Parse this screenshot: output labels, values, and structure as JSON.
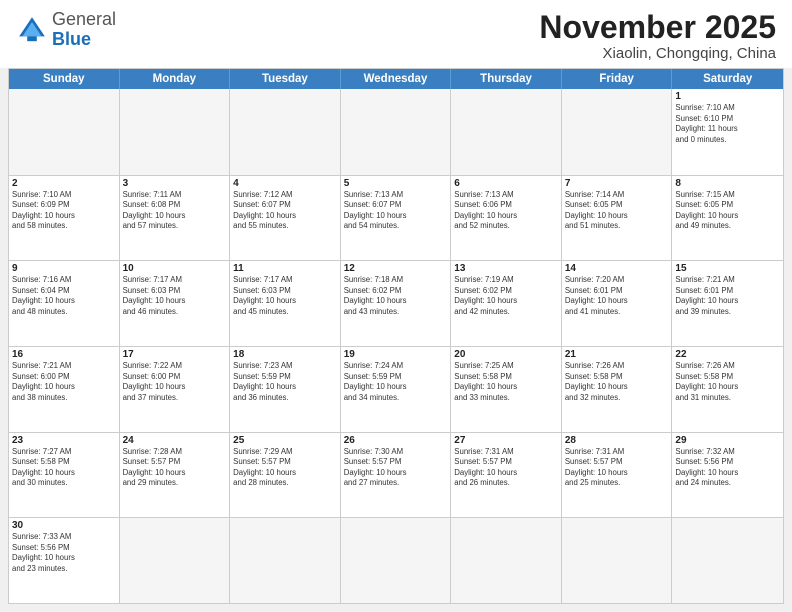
{
  "header": {
    "logo_general": "General",
    "logo_blue": "Blue",
    "month_title": "November 2025",
    "location": "Xiaolin, Chongqing, China"
  },
  "weekdays": [
    "Sunday",
    "Monday",
    "Tuesday",
    "Wednesday",
    "Thursday",
    "Friday",
    "Saturday"
  ],
  "weeks": [
    [
      {
        "day": "",
        "info": "",
        "empty": true
      },
      {
        "day": "",
        "info": "",
        "empty": true
      },
      {
        "day": "",
        "info": "",
        "empty": true
      },
      {
        "day": "",
        "info": "",
        "empty": true
      },
      {
        "day": "",
        "info": "",
        "empty": true
      },
      {
        "day": "",
        "info": "",
        "empty": true
      },
      {
        "day": "1",
        "info": "Sunrise: 7:10 AM\nSunset: 6:10 PM\nDaylight: 11 hours\nand 0 minutes.",
        "empty": false
      }
    ],
    [
      {
        "day": "2",
        "info": "Sunrise: 7:10 AM\nSunset: 6:09 PM\nDaylight: 10 hours\nand 58 minutes.",
        "empty": false
      },
      {
        "day": "3",
        "info": "Sunrise: 7:11 AM\nSunset: 6:08 PM\nDaylight: 10 hours\nand 57 minutes.",
        "empty": false
      },
      {
        "day": "4",
        "info": "Sunrise: 7:12 AM\nSunset: 6:07 PM\nDaylight: 10 hours\nand 55 minutes.",
        "empty": false
      },
      {
        "day": "5",
        "info": "Sunrise: 7:13 AM\nSunset: 6:07 PM\nDaylight: 10 hours\nand 54 minutes.",
        "empty": false
      },
      {
        "day": "6",
        "info": "Sunrise: 7:13 AM\nSunset: 6:06 PM\nDaylight: 10 hours\nand 52 minutes.",
        "empty": false
      },
      {
        "day": "7",
        "info": "Sunrise: 7:14 AM\nSunset: 6:05 PM\nDaylight: 10 hours\nand 51 minutes.",
        "empty": false
      },
      {
        "day": "8",
        "info": "Sunrise: 7:15 AM\nSunset: 6:05 PM\nDaylight: 10 hours\nand 49 minutes.",
        "empty": false
      }
    ],
    [
      {
        "day": "9",
        "info": "Sunrise: 7:16 AM\nSunset: 6:04 PM\nDaylight: 10 hours\nand 48 minutes.",
        "empty": false
      },
      {
        "day": "10",
        "info": "Sunrise: 7:17 AM\nSunset: 6:03 PM\nDaylight: 10 hours\nand 46 minutes.",
        "empty": false
      },
      {
        "day": "11",
        "info": "Sunrise: 7:17 AM\nSunset: 6:03 PM\nDaylight: 10 hours\nand 45 minutes.",
        "empty": false
      },
      {
        "day": "12",
        "info": "Sunrise: 7:18 AM\nSunset: 6:02 PM\nDaylight: 10 hours\nand 43 minutes.",
        "empty": false
      },
      {
        "day": "13",
        "info": "Sunrise: 7:19 AM\nSunset: 6:02 PM\nDaylight: 10 hours\nand 42 minutes.",
        "empty": false
      },
      {
        "day": "14",
        "info": "Sunrise: 7:20 AM\nSunset: 6:01 PM\nDaylight: 10 hours\nand 41 minutes.",
        "empty": false
      },
      {
        "day": "15",
        "info": "Sunrise: 7:21 AM\nSunset: 6:01 PM\nDaylight: 10 hours\nand 39 minutes.",
        "empty": false
      }
    ],
    [
      {
        "day": "16",
        "info": "Sunrise: 7:21 AM\nSunset: 6:00 PM\nDaylight: 10 hours\nand 38 minutes.",
        "empty": false
      },
      {
        "day": "17",
        "info": "Sunrise: 7:22 AM\nSunset: 6:00 PM\nDaylight: 10 hours\nand 37 minutes.",
        "empty": false
      },
      {
        "day": "18",
        "info": "Sunrise: 7:23 AM\nSunset: 5:59 PM\nDaylight: 10 hours\nand 36 minutes.",
        "empty": false
      },
      {
        "day": "19",
        "info": "Sunrise: 7:24 AM\nSunset: 5:59 PM\nDaylight: 10 hours\nand 34 minutes.",
        "empty": false
      },
      {
        "day": "20",
        "info": "Sunrise: 7:25 AM\nSunset: 5:58 PM\nDaylight: 10 hours\nand 33 minutes.",
        "empty": false
      },
      {
        "day": "21",
        "info": "Sunrise: 7:26 AM\nSunset: 5:58 PM\nDaylight: 10 hours\nand 32 minutes.",
        "empty": false
      },
      {
        "day": "22",
        "info": "Sunrise: 7:26 AM\nSunset: 5:58 PM\nDaylight: 10 hours\nand 31 minutes.",
        "empty": false
      }
    ],
    [
      {
        "day": "23",
        "info": "Sunrise: 7:27 AM\nSunset: 5:58 PM\nDaylight: 10 hours\nand 30 minutes.",
        "empty": false
      },
      {
        "day": "24",
        "info": "Sunrise: 7:28 AM\nSunset: 5:57 PM\nDaylight: 10 hours\nand 29 minutes.",
        "empty": false
      },
      {
        "day": "25",
        "info": "Sunrise: 7:29 AM\nSunset: 5:57 PM\nDaylight: 10 hours\nand 28 minutes.",
        "empty": false
      },
      {
        "day": "26",
        "info": "Sunrise: 7:30 AM\nSunset: 5:57 PM\nDaylight: 10 hours\nand 27 minutes.",
        "empty": false
      },
      {
        "day": "27",
        "info": "Sunrise: 7:31 AM\nSunset: 5:57 PM\nDaylight: 10 hours\nand 26 minutes.",
        "empty": false
      },
      {
        "day": "28",
        "info": "Sunrise: 7:31 AM\nSunset: 5:57 PM\nDaylight: 10 hours\nand 25 minutes.",
        "empty": false
      },
      {
        "day": "29",
        "info": "Sunrise: 7:32 AM\nSunset: 5:56 PM\nDaylight: 10 hours\nand 24 minutes.",
        "empty": false
      }
    ],
    [
      {
        "day": "30",
        "info": "Sunrise: 7:33 AM\nSunset: 5:56 PM\nDaylight: 10 hours\nand 23 minutes.",
        "empty": false
      },
      {
        "day": "",
        "info": "",
        "empty": true
      },
      {
        "day": "",
        "info": "",
        "empty": true
      },
      {
        "day": "",
        "info": "",
        "empty": true
      },
      {
        "day": "",
        "info": "",
        "empty": true
      },
      {
        "day": "",
        "info": "",
        "empty": true
      },
      {
        "day": "",
        "info": "",
        "empty": true
      }
    ]
  ]
}
